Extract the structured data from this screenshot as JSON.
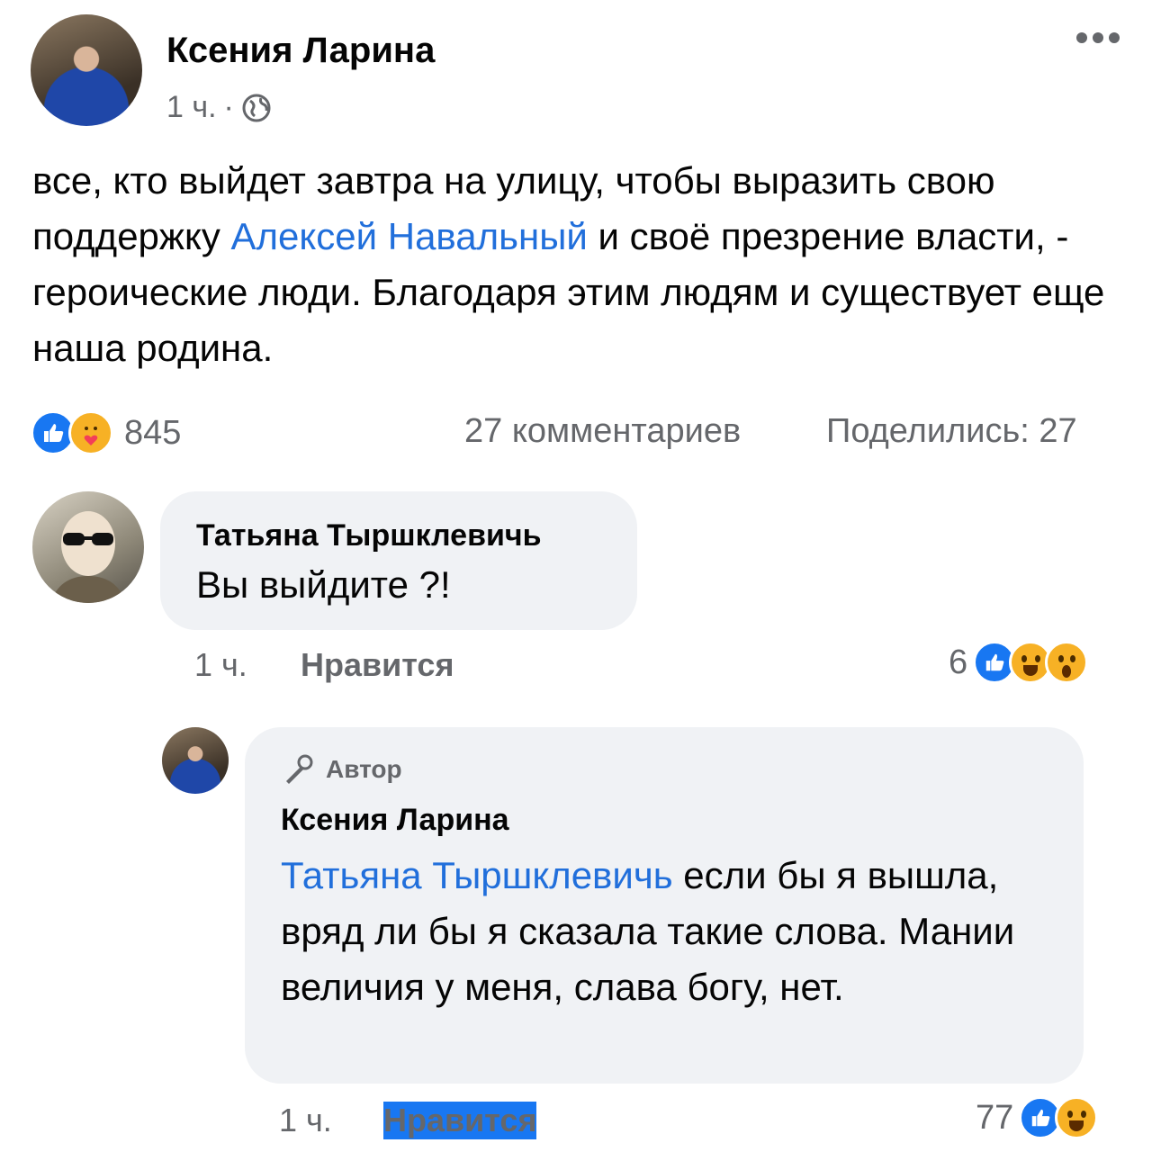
{
  "post": {
    "author": "Ксения Ларина",
    "time": "1 ч.",
    "separator": "·",
    "text_before": "все, кто выйдет завтра на улицу, чтобы выразить свою поддержку ",
    "mention": "Алексей Навальный",
    "text_after": " и своё презрение власти, - героические люди. Благодаря этим людям и существует еще наша родина.",
    "reaction_count": "845",
    "comments_label": "27 комментариев",
    "shares_label": "Поделились: 27",
    "colors": {
      "link": "#216fdb",
      "like": "#1877f2",
      "muted": "#65676b",
      "bubble": "#f0f2f5"
    }
  },
  "comment": {
    "author": "Татьяна Тыршклевичь",
    "text": "Вы выйдите ?!",
    "time": "1 ч.",
    "like_label": "Нравится",
    "reaction_count": "6"
  },
  "reply": {
    "badge": "Автор",
    "author": "Ксения Ларина",
    "mention": "Татьяна Тыршклевичь",
    "text": " если бы я вышла, вряд ли бы я сказала такие слова. Мании величия у меня, слава богу, нет.",
    "time": "1 ч.",
    "like_label": "Нравится",
    "reaction_count": "77"
  }
}
